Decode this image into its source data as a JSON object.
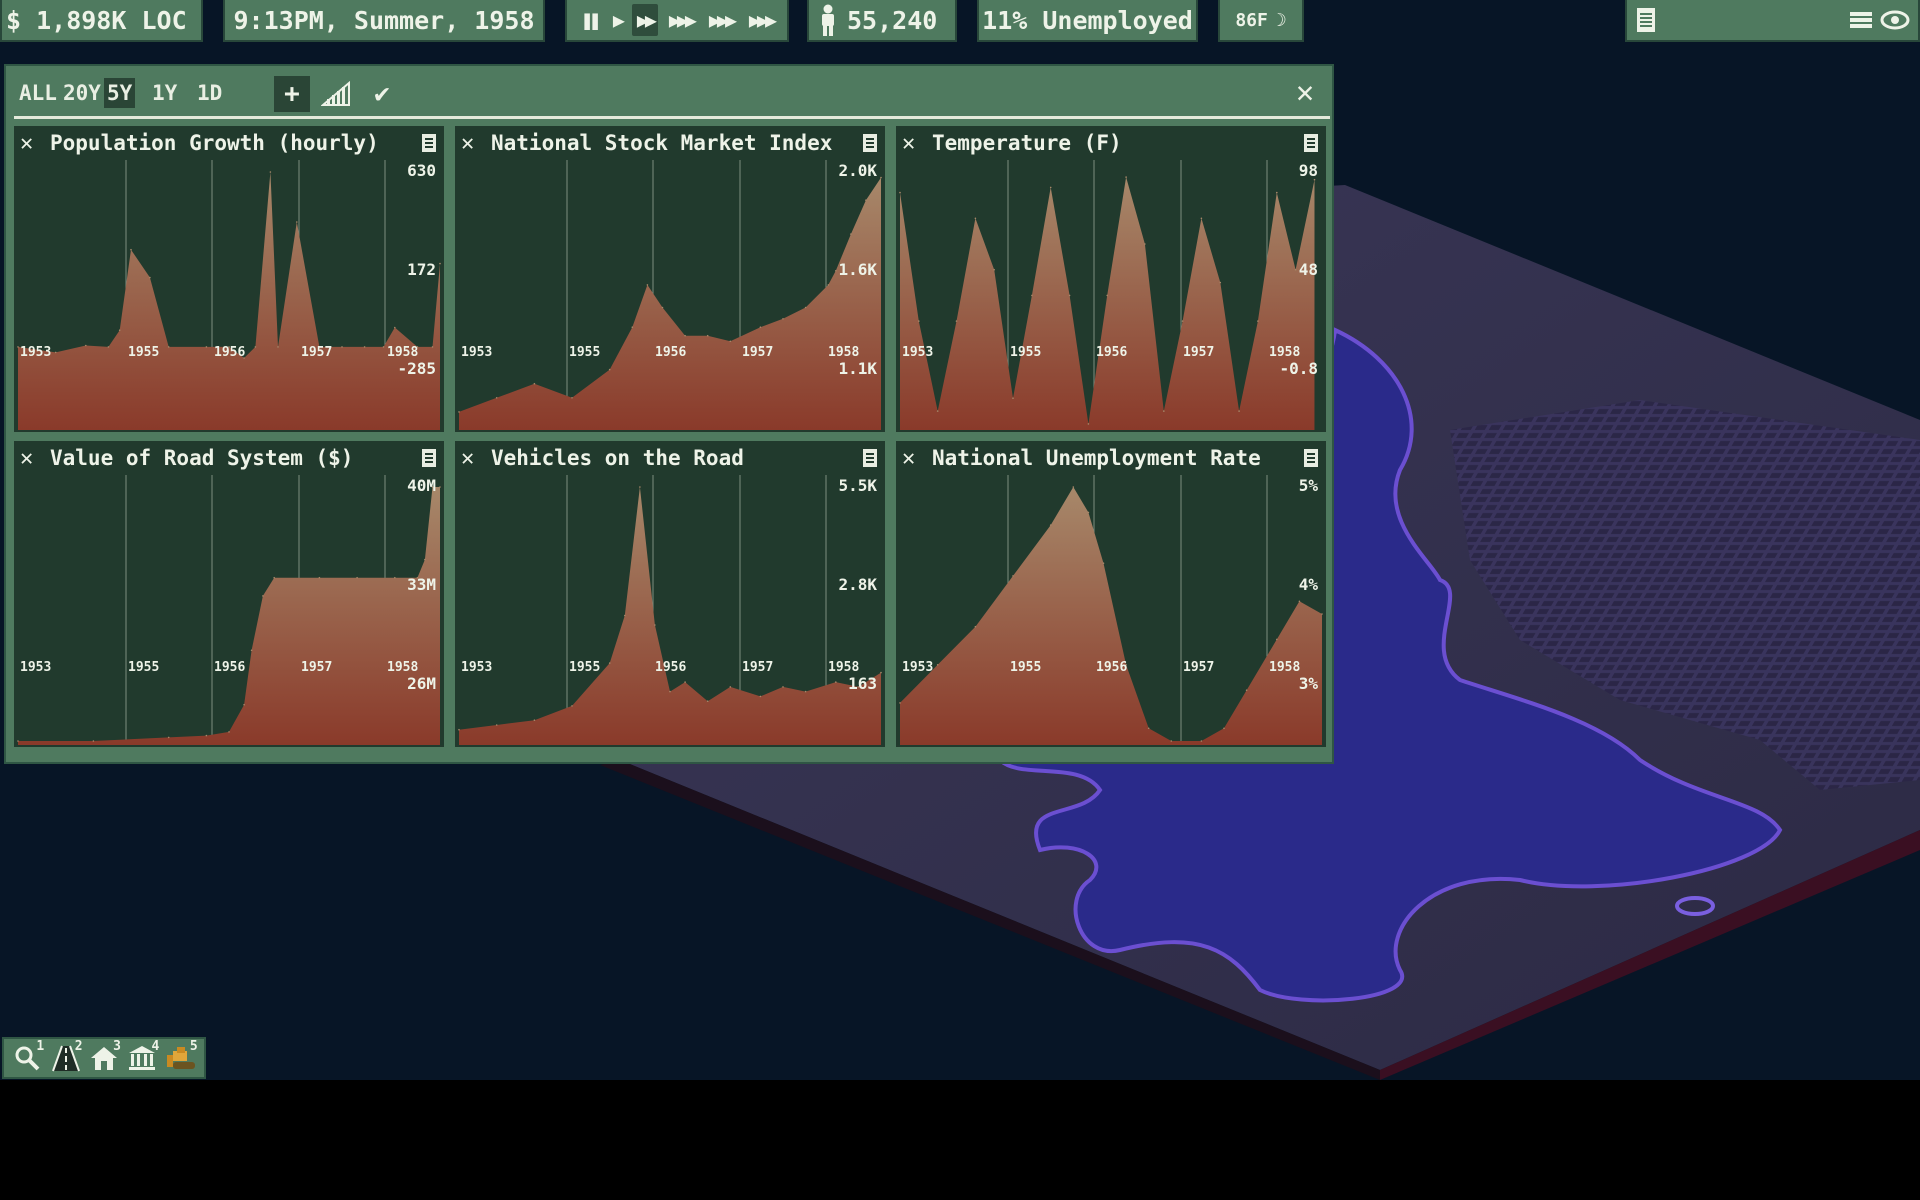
{
  "topbar": {
    "money": "$ 1,898K LOC",
    "datetime": "9:13PM, Summer, 1958",
    "population": "55,240",
    "unemployment": "11% Unemployed",
    "temperature": "86F",
    "speed_icons": [
      "pause-icon",
      "play-icon",
      "fast-forward-icon",
      "speed-3-icon",
      "speed-4-icon",
      "speed-5-icon"
    ]
  },
  "graphs": {
    "ranges": [
      "ALL",
      "20Y",
      "5Y",
      "1Y",
      "1D"
    ],
    "active_range": "5Y",
    "panels": [
      {
        "title": "Population Growth (hourly)",
        "y_labels": [
          "630",
          "172",
          "-285"
        ]
      },
      {
        "title": "National Stock Market Index",
        "y_labels": [
          "2.0K",
          "1.6K",
          "1.1K"
        ]
      },
      {
        "title": "Temperature (F)",
        "y_labels": [
          "98",
          "48",
          "-0.8"
        ]
      },
      {
        "title": "Value of Road System ($)",
        "y_labels": [
          "40M",
          "33M",
          "26M"
        ]
      },
      {
        "title": "Vehicles on the Road",
        "y_labels": [
          "5.5K",
          "2.8K",
          "163"
        ]
      },
      {
        "title": "National Unemployment Rate",
        "y_labels": [
          "5%",
          "4%",
          "3%"
        ]
      }
    ],
    "x_labels": [
      "1953",
      "1955",
      "1956",
      "1957",
      "1958"
    ]
  },
  "chart_data": [
    {
      "type": "area",
      "title": "Population Growth (hourly)",
      "ylim": [
        -285,
        630
      ],
      "x": [
        1953,
        1953.5,
        1953.9,
        1954.2,
        1954.35,
        1954.5,
        1954.75,
        1955,
        1955.5,
        1955.8,
        1956,
        1956.15,
        1956.35,
        1956.45,
        1956.7,
        1957,
        1957.3,
        1957.6,
        1957.85,
        1958,
        1958.3,
        1958.5,
        1958.6
      ],
      "values": [
        0,
        -20,
        5,
        0,
        60,
        350,
        250,
        0,
        0,
        0,
        -40,
        0,
        630,
        0,
        450,
        0,
        0,
        0,
        0,
        70,
        0,
        0,
        300
      ]
    },
    {
      "type": "area",
      "title": "National Stock Market Index",
      "ylim": [
        1100,
        2000
      ],
      "x": [
        1953,
        1953.5,
        1954,
        1954.5,
        1955,
        1955.3,
        1955.5,
        1955.7,
        1956,
        1956.3,
        1956.6,
        1957,
        1957.3,
        1957.6,
        1957.9,
        1958,
        1958.2,
        1958.4,
        1958.6
      ],
      "values": [
        1150,
        1200,
        1250,
        1200,
        1300,
        1450,
        1600,
        1520,
        1420,
        1420,
        1400,
        1450,
        1480,
        1520,
        1600,
        1650,
        1780,
        1900,
        1980
      ]
    },
    {
      "type": "area",
      "title": "Temperature (F)",
      "ylim": [
        -0.8,
        98
      ],
      "x": [
        1953,
        1953.25,
        1953.5,
        1953.75,
        1954,
        1954.25,
        1954.5,
        1954.75,
        1955,
        1955.25,
        1955.5,
        1955.75,
        1956,
        1956.25,
        1956.5,
        1956.75,
        1957,
        1957.25,
        1957.5,
        1957.75,
        1958,
        1958.25,
        1958.5
      ],
      "values": [
        90,
        40,
        5,
        40,
        80,
        60,
        10,
        50,
        92,
        50,
        0,
        50,
        96,
        70,
        5,
        40,
        80,
        55,
        5,
        40,
        90,
        60,
        95
      ]
    },
    {
      "type": "area",
      "title": "Value of Road System ($)",
      "ylim": [
        26,
        40
      ],
      "x": [
        1953,
        1954,
        1955,
        1955.5,
        1955.8,
        1956,
        1956.1,
        1956.25,
        1956.4,
        1957,
        1957.5,
        1958,
        1958.3,
        1958.4,
        1958.5,
        1958.6
      ],
      "values": [
        26,
        26,
        26.2,
        26.3,
        26.5,
        28,
        31,
        34,
        35,
        35,
        35,
        35,
        35,
        36,
        40,
        40
      ]
    },
    {
      "type": "area",
      "title": "Vehicles on the Road",
      "ylim": [
        163,
        5500
      ],
      "x": [
        1953,
        1953.5,
        1954,
        1954.5,
        1955,
        1955.2,
        1955.4,
        1955.6,
        1955.8,
        1956,
        1956.3,
        1956.6,
        1957,
        1957.3,
        1957.6,
        1958,
        1958.3,
        1958.6
      ],
      "values": [
        400,
        500,
        600,
        900,
        1800,
        2800,
        5500,
        2600,
        1200,
        1400,
        1000,
        1300,
        1100,
        1300,
        1200,
        1400,
        1300,
        1600
      ]
    },
    {
      "type": "area",
      "title": "National Unemployment Rate",
      "ylim": [
        3,
        5
      ],
      "x": [
        1953,
        1953.5,
        1954,
        1954.5,
        1955,
        1955.3,
        1955.5,
        1955.7,
        1956,
        1956.3,
        1956.6,
        1957,
        1957.3,
        1957.6,
        1958,
        1958.3,
        1958.6
      ],
      "values": [
        3.3,
        3.6,
        3.9,
        4.3,
        4.7,
        5.0,
        4.8,
        4.4,
        3.6,
        3.1,
        3.0,
        3.0,
        3.1,
        3.4,
        3.8,
        4.1,
        4.0
      ]
    }
  ],
  "dock": {
    "tools": [
      {
        "icon": "magnifier-icon",
        "key": "1"
      },
      {
        "icon": "road-icon",
        "key": "2"
      },
      {
        "icon": "house-icon",
        "key": "3"
      },
      {
        "icon": "government-building-icon",
        "key": "4"
      },
      {
        "icon": "bulldozer-icon",
        "key": "5"
      }
    ]
  },
  "colors": {
    "panel_bg": "#213a2d",
    "window_bg": "#4f7a5f",
    "area_top": "#a7886a",
    "area_bottom": "#8a3a2a"
  }
}
